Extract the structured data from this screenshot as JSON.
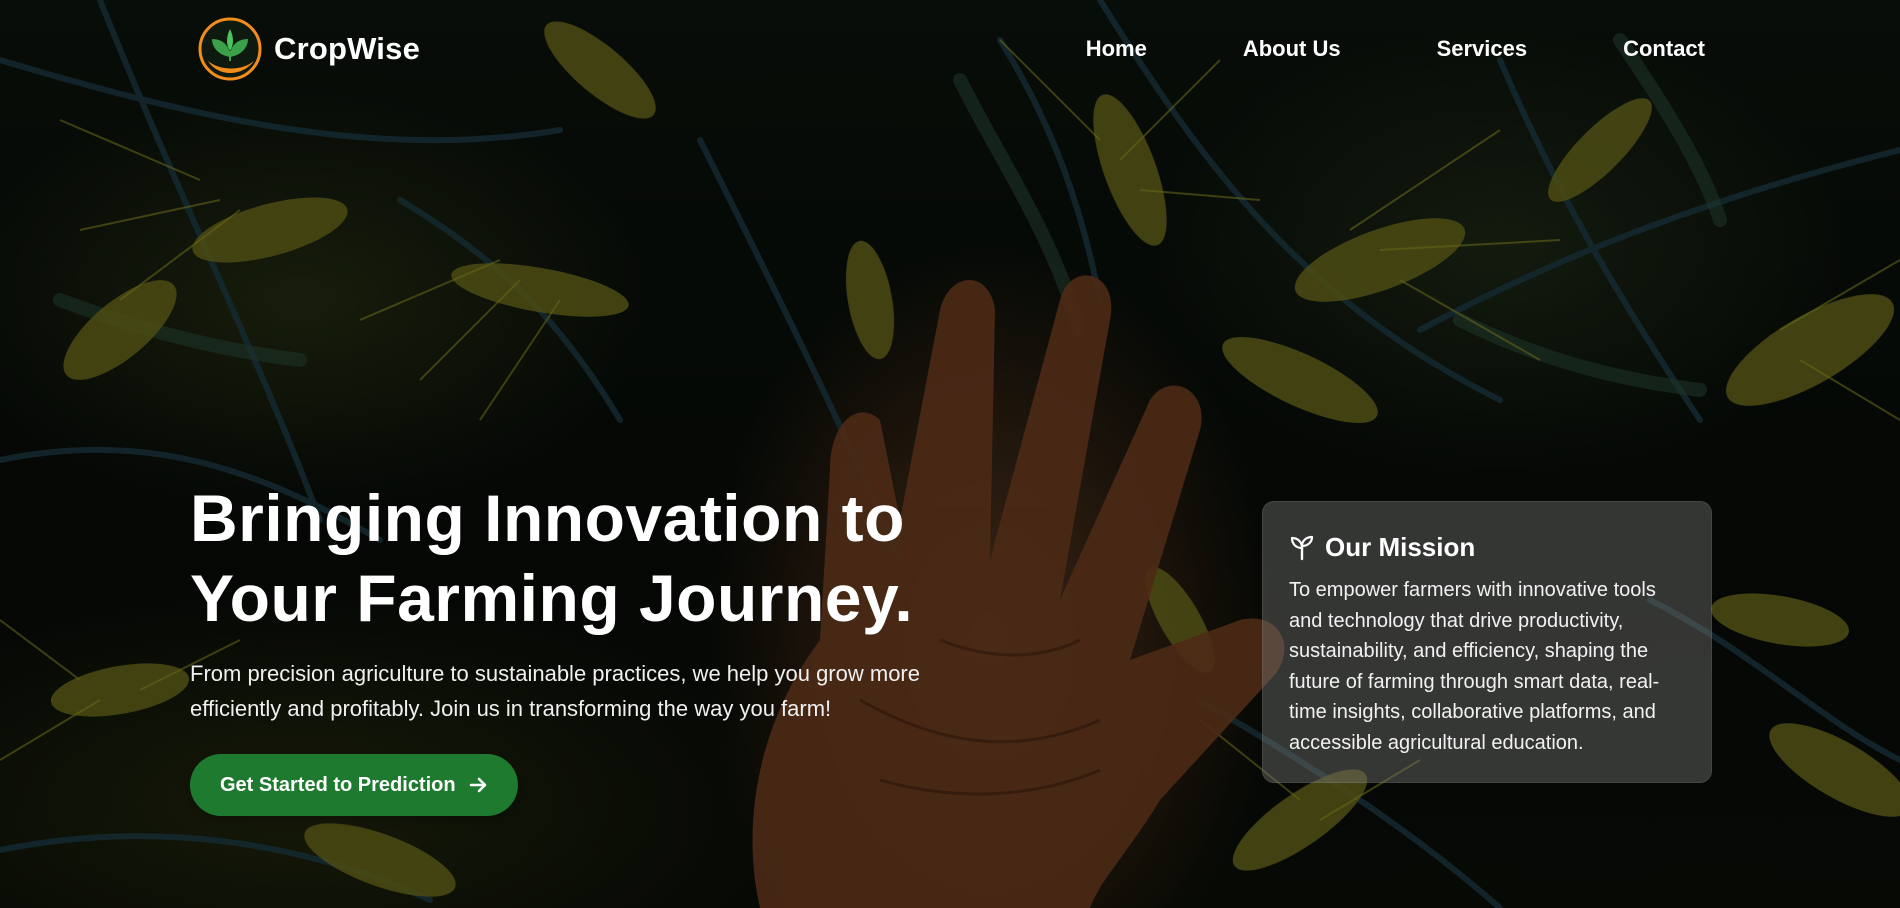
{
  "brand": {
    "name": "CropWise",
    "logo_icon": "leaf-sprout-logo-icon",
    "accent": "#f28c1a",
    "leaf_color": "#3aa14a"
  },
  "nav": {
    "links": [
      {
        "label": "Home"
      },
      {
        "label": "About Us"
      },
      {
        "label": "Services"
      },
      {
        "label": "Contact"
      }
    ]
  },
  "hero": {
    "title_line1": "Bringing Innovation to",
    "title_line2": "Your Farming Journey.",
    "subtitle": "From precision agriculture to sustainable practices, we help you grow more efficiently and profitably. Join us in transforming the way you farm!",
    "cta_label": "Get Started to Prediction",
    "cta_icon": "arrow-right-icon",
    "cta_color": "#1e7a2f"
  },
  "mission": {
    "icon": "sprout-icon",
    "title": "Our Mission",
    "text": "To empower farmers with innovative tools and technology that drive productivity, sustainability, and efficiency, shaping the future of farming through smart data, real-time insights, collaborative platforms, and accessible agricultural education."
  }
}
